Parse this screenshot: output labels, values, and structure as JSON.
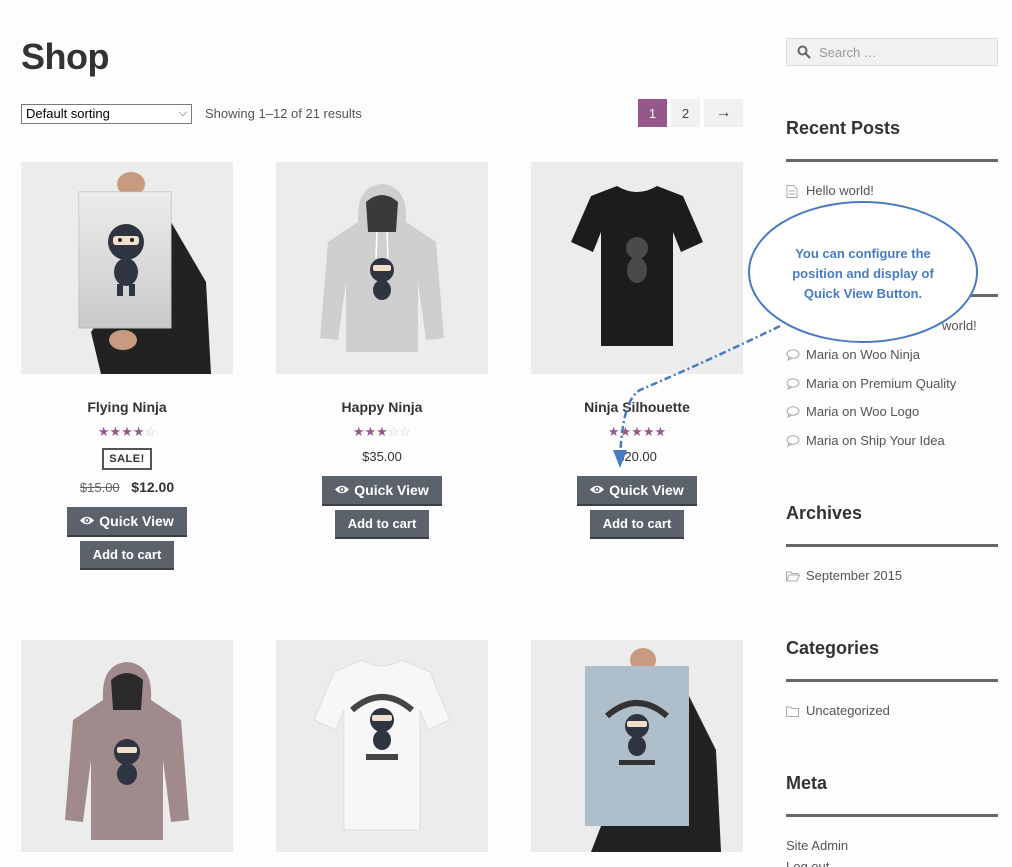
{
  "page": {
    "title": "Shop"
  },
  "toolbar": {
    "sort_value": "Default sorting",
    "result_count": "Showing 1–12 of 21 results"
  },
  "pagination": {
    "pages": [
      "1",
      "2"
    ],
    "next": "→",
    "current": "1"
  },
  "products": [
    {
      "name": "Flying Ninja",
      "rating": 4,
      "sale_badge": "SALE!",
      "old_price": "$15.00",
      "price": "$12.00",
      "quick_view": "Quick View",
      "add_to_cart": "Add to cart"
    },
    {
      "name": "Happy Ninja",
      "rating": 3,
      "price": "$35.00",
      "quick_view": "Quick View",
      "add_to_cart": "Add to cart"
    },
    {
      "name": "Ninja Silhouette",
      "rating": 5,
      "price": "$20.00",
      "quick_view": "Quick View",
      "add_to_cart": "Add to cart"
    },
    {
      "name": "",
      "image": "hoodie-pink"
    },
    {
      "name": "",
      "image": "tshirt-white"
    },
    {
      "name": "",
      "image": "poster-blue"
    }
  ],
  "sidebar": {
    "search_placeholder": "Search …",
    "recent_posts_title": "Recent Posts",
    "recent_posts": [
      "Hello world!"
    ],
    "recent_comments_partial": "world!",
    "recent_comments": [
      "Maria on Woo Ninja",
      "Maria on Premium Quality",
      "Maria on Woo Logo",
      "Maria on Ship Your Idea"
    ],
    "archives_title": "Archives",
    "archives": [
      "September 2015"
    ],
    "categories_title": "Categories",
    "categories": [
      "Uncategorized"
    ],
    "meta_title": "Meta",
    "meta": [
      "Site Admin",
      "Log out"
    ]
  },
  "callout": {
    "text": "You can configure the position and display of Quick View Button."
  },
  "colors": {
    "accent": "#96588a",
    "button": "#5b626c",
    "callout": "#4a7bc1"
  }
}
